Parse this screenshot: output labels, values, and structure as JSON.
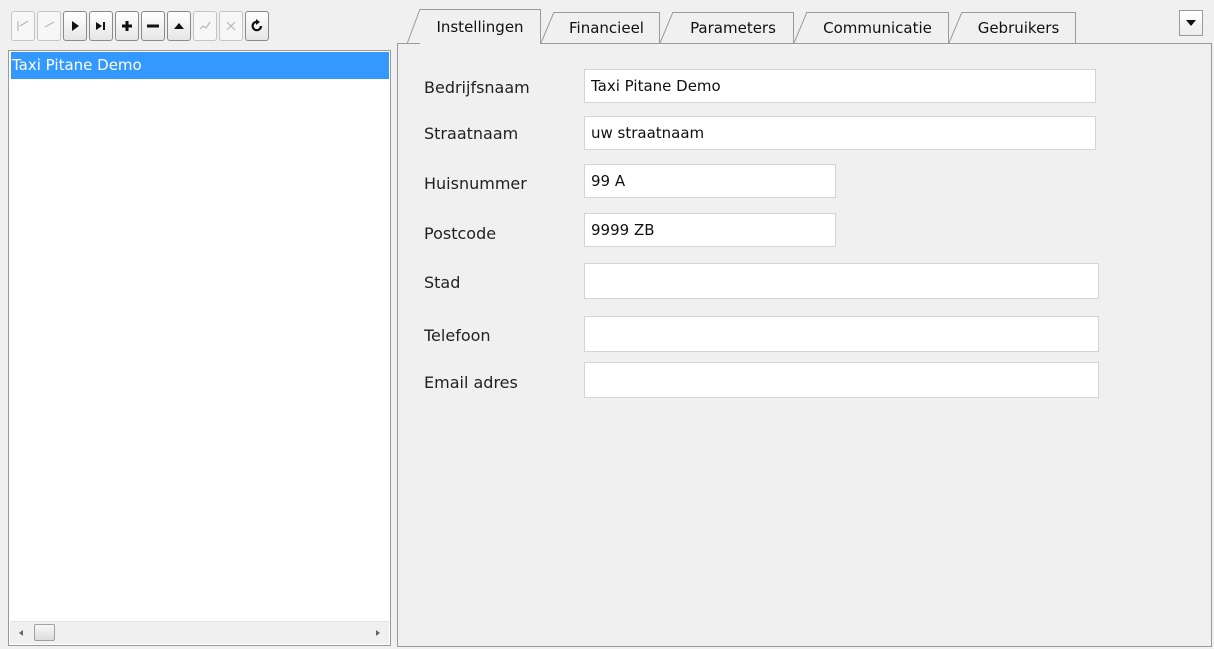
{
  "toolbar": {
    "buttons": [
      {
        "icon": "first-record-icon",
        "enabled": false
      },
      {
        "icon": "prior-record-icon",
        "enabled": false
      },
      {
        "icon": "next-record-icon",
        "enabled": true
      },
      {
        "icon": "last-record-icon",
        "enabled": true
      },
      {
        "icon": "insert-record-icon",
        "enabled": true
      },
      {
        "icon": "delete-record-icon",
        "enabled": true
      },
      {
        "icon": "edit-record-icon",
        "enabled": true
      },
      {
        "icon": "post-edit-icon",
        "enabled": false
      },
      {
        "icon": "cancel-edit-icon",
        "enabled": false
      },
      {
        "icon": "refresh-icon",
        "enabled": true
      }
    ]
  },
  "list": {
    "items": [
      "Taxi Pitane Demo"
    ],
    "selected_color": "#3399ff"
  },
  "tabs": [
    {
      "label": "Instellingen",
      "active": true
    },
    {
      "label": "Financieel",
      "active": false
    },
    {
      "label": "Parameters",
      "active": false
    },
    {
      "label": "Communicatie",
      "active": false
    },
    {
      "label": "Gebruikers",
      "active": false
    }
  ],
  "form": {
    "fields": [
      {
        "label": "Bedrijfsnaam",
        "value": "Taxi Pitane Demo"
      },
      {
        "label": "Straatnaam",
        "value": "uw straatnaam"
      },
      {
        "label": "Huisnummer",
        "value": "99 A"
      },
      {
        "label": "Postcode",
        "value": "9999 ZB"
      },
      {
        "label": "Stad",
        "value": ""
      },
      {
        "label": "Telefoon",
        "value": ""
      },
      {
        "label": "Email adres",
        "value": ""
      }
    ]
  }
}
